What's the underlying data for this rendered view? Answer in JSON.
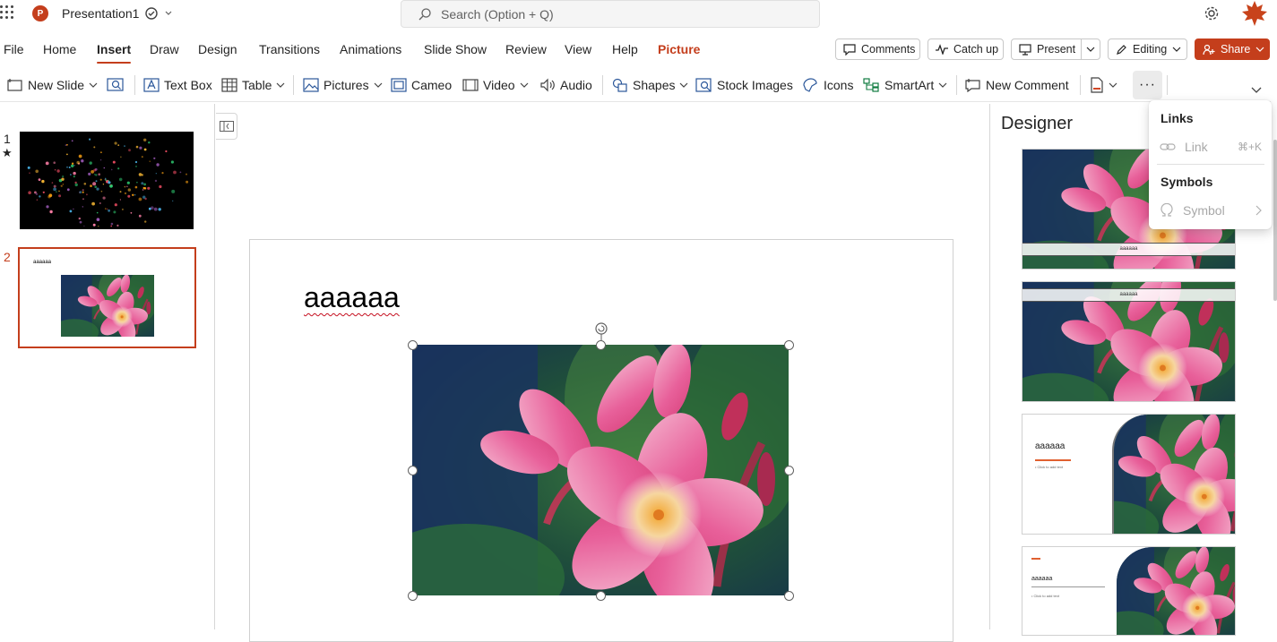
{
  "app": {
    "doc_title": "Presentation1",
    "search_placeholder": "Search (Option + Q)"
  },
  "tabs": [
    "File",
    "Home",
    "Insert",
    "Draw",
    "Design",
    "Transitions",
    "Animations",
    "Slide Show",
    "Review",
    "View",
    "Help",
    "Picture"
  ],
  "active_tab": "Insert",
  "context_tab": "Picture",
  "header_buttons": {
    "comments": "Comments",
    "catch_up": "Catch up",
    "present": "Present",
    "editing": "Editing",
    "share": "Share"
  },
  "ribbon": {
    "new_slide": "New Slide",
    "text_box": "Text Box",
    "table": "Table",
    "pictures": "Pictures",
    "cameo": "Cameo",
    "video": "Video",
    "audio": "Audio",
    "shapes": "Shapes",
    "stock_images": "Stock Images",
    "icons": "Icons",
    "smartart": "SmartArt",
    "new_comment": "New Comment",
    "more": "···"
  },
  "slides": [
    {
      "number": "1",
      "marker": "★"
    },
    {
      "number": "2",
      "title": "aaaaaa"
    }
  ],
  "current_slide": {
    "title": "aaaaaa"
  },
  "designer": {
    "title": "Designer",
    "cards": [
      {
        "title": "aaaaaa"
      },
      {
        "title": "aaaaaa"
      },
      {
        "title": "aaaaaa",
        "bullet": "• Click to add text"
      },
      {
        "title": "aaaaaa",
        "bullet": "• Click to add text"
      }
    ]
  },
  "overflow_menu": {
    "links_header": "Links",
    "link_label": "Link",
    "link_shortcut": "⌘+K",
    "symbols_header": "Symbols",
    "symbol_label": "Symbol"
  },
  "colors": {
    "accent": "#c43e1c",
    "text": "#242424",
    "disabled": "#a8a8a8"
  }
}
